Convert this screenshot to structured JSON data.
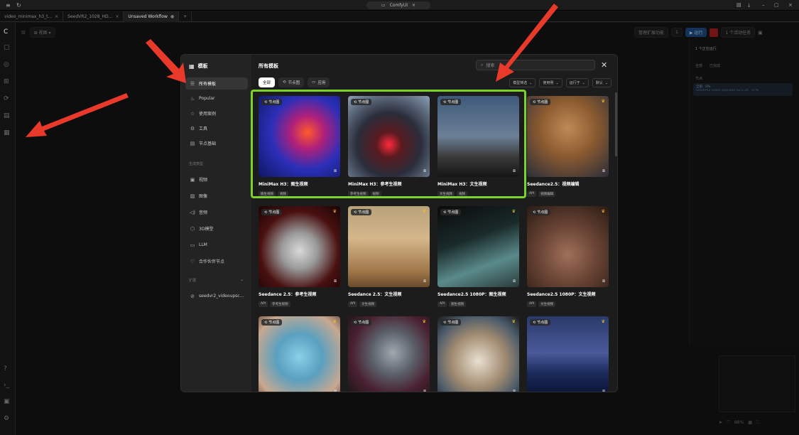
{
  "window": {
    "app_title": "ComfyUI"
  },
  "workflow_tabs": [
    {
      "label": "video_minimax_h3_t...",
      "active": false
    },
    {
      "label": "SeedVR2_1028_HD...",
      "active": false
    },
    {
      "label": "Unsaved Workflow",
      "active": true
    }
  ],
  "toolbar": {
    "view_label": "视图"
  },
  "run": {
    "count": "1",
    "run_label": "运行",
    "tasks_label": "1 个活动任务",
    "manage_label": "管理扩展功能"
  },
  "right_panel": {
    "running_label": "1 个正在运行",
    "tab_all": "全部",
    "tab_done": "已完成",
    "section": "节点",
    "queue_text": "全部 · 0%",
    "queue_sub": "SeedVR2 Video Upscaler v2.5.24 · 47%"
  },
  "zoom": "88%",
  "dialog": {
    "title": "模板",
    "heading": "所有模板",
    "search_placeholder": "搜索",
    "nav": [
      {
        "label": "所有模板",
        "icon": "list-icon",
        "glyph": "☰",
        "active": true
      },
      {
        "label": "Popular",
        "icon": "flame-icon",
        "glyph": "♨",
        "active": false
      },
      {
        "label": "使用案例",
        "icon": "star-icon",
        "glyph": "☆",
        "active": false
      },
      {
        "label": "工具",
        "icon": "tool-icon",
        "glyph": "⚙",
        "active": false
      },
      {
        "label": "节点基础",
        "icon": "book-icon",
        "glyph": "▤",
        "active": false
      }
    ],
    "section_generate": "生成类型",
    "generate_nav": [
      {
        "label": "视频",
        "icon": "video-icon",
        "glyph": "▣"
      },
      {
        "label": "图像",
        "icon": "image-icon",
        "glyph": "▨"
      },
      {
        "label": "音频",
        "icon": "audio-icon",
        "glyph": "◁)"
      },
      {
        "label": "3D模型",
        "icon": "cube-icon",
        "glyph": "⬡"
      },
      {
        "label": "LLM",
        "icon": "llm-icon",
        "glyph": "▭"
      },
      {
        "label": "合作伙伴节点",
        "icon": "partner-icon",
        "glyph": "♡"
      }
    ],
    "section_ext": "扩展",
    "ext_item": "seedvr2_videoupsc...",
    "filters": [
      {
        "label": "全部",
        "active": true
      },
      {
        "label": "节点图",
        "active": false
      },
      {
        "label": "应用",
        "active": false
      }
    ],
    "dropdowns": [
      "模型筛选",
      "使用例",
      "运行于",
      "默认"
    ],
    "cards": [
      {
        "title": "MiniMax H3：图生视频",
        "badge": "节点图",
        "tags": [
          "图生视频",
          "视频"
        ],
        "crown": false,
        "thumb": "t1"
      },
      {
        "title": "MiniMax H3：参考生视频",
        "badge": "节点图",
        "tags": [
          "参考生视频",
          "视频"
        ],
        "crown": false,
        "thumb": "t2"
      },
      {
        "title": "MiniMax H3：文生视频",
        "badge": "节点图",
        "tags": [
          "文生视频",
          "视频"
        ],
        "crown": false,
        "thumb": "t3"
      },
      {
        "title": "Seedance2.5：视频编辑",
        "badge": "节点图",
        "tags": [
          "API",
          "视频编辑"
        ],
        "crown": true,
        "thumb": "t4"
      },
      {
        "title": "Seedance 2.5：参考生视频",
        "badge": "节点图",
        "tags": [
          "API",
          "参考生视频"
        ],
        "crown": true,
        "thumb": "t5"
      },
      {
        "title": "Seedance 2.5：文生视频",
        "badge": "节点图",
        "tags": [
          "API",
          "文生视频"
        ],
        "crown": true,
        "thumb": "t6"
      },
      {
        "title": "Seedance2.5 1080P：图生视频",
        "badge": "节点图",
        "tags": [
          "API",
          "图生视频"
        ],
        "crown": true,
        "thumb": "t7"
      },
      {
        "title": "Seedance2.5 1080P：文生视频",
        "badge": "节点图",
        "tags": [
          "API",
          "文生视频"
        ],
        "crown": true,
        "thumb": "t8"
      },
      {
        "title": "",
        "badge": "节点图",
        "tags": [],
        "crown": true,
        "thumb": "t9"
      },
      {
        "title": "",
        "badge": "节点图",
        "tags": [],
        "crown": true,
        "thumb": "t10"
      },
      {
        "title": "",
        "badge": "节点图",
        "tags": [],
        "crown": true,
        "thumb": "t11"
      },
      {
        "title": "",
        "badge": "节点图",
        "tags": [],
        "crown": true,
        "thumb": "t12"
      }
    ]
  },
  "colors": {
    "highlight": "#7ad22b",
    "arrow": "#e8392b",
    "accent": "#1e4f8a"
  }
}
